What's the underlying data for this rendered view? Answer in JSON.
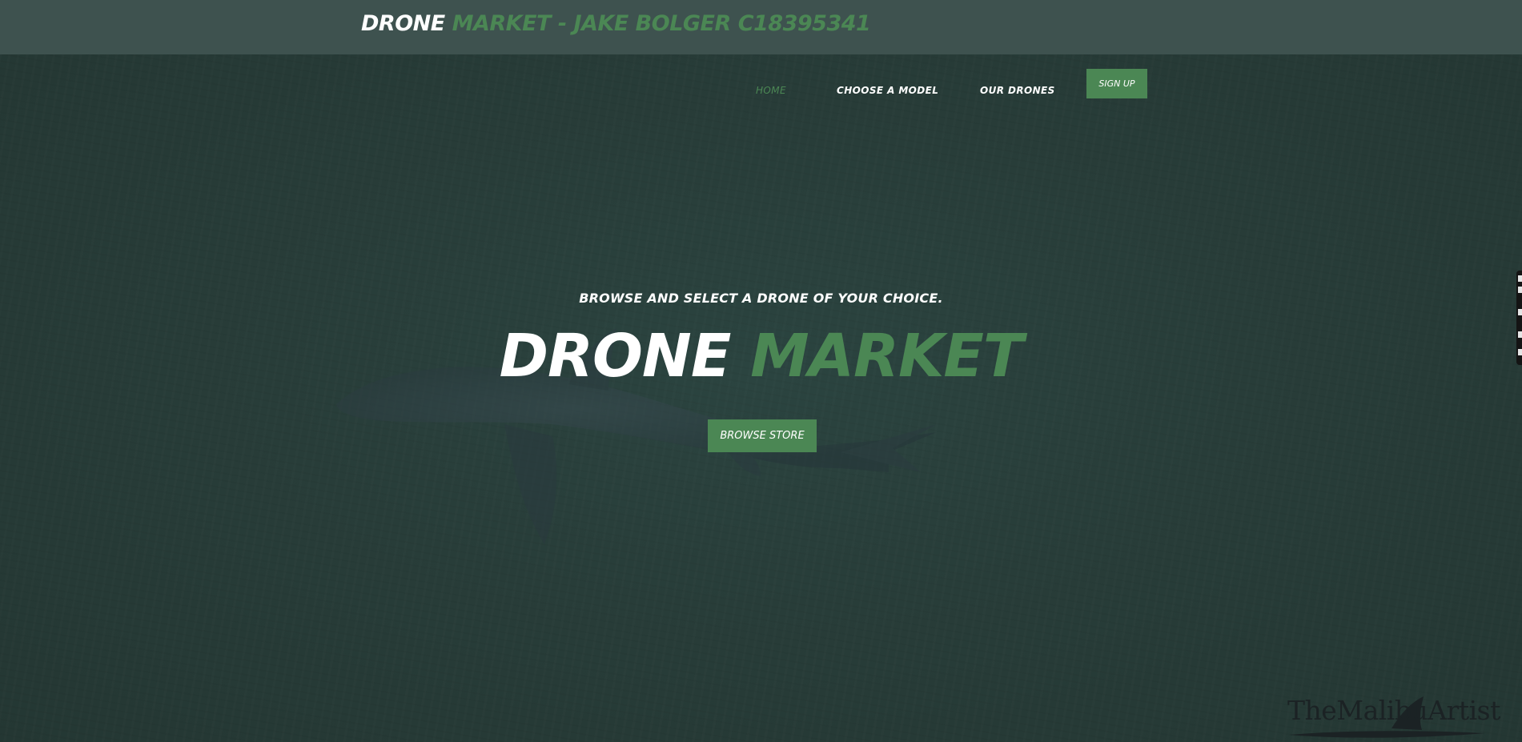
{
  "header": {
    "brand_white": "DRONE",
    "brand_green": "MARKET - JAKE BOLGER C18395341"
  },
  "nav": {
    "items": [
      {
        "label": "HOME",
        "active": true
      },
      {
        "label": "CHOOSE A MODEL",
        "active": false
      },
      {
        "label": "OUR DRONES",
        "active": false
      }
    ],
    "signup_label": "SIGN UP"
  },
  "hero": {
    "tagline": "BROWSE AND SELECT A DRONE OF YOUR CHOICE.",
    "title_white": "DRONE",
    "title_green": "MARKET",
    "button_label": "BROWSE STORE"
  },
  "watermark": {
    "text": "TheMalibuArtist"
  },
  "colors": {
    "accent": "#4b8754",
    "background": "#283d39",
    "topbar": "#3e524f",
    "text": "#ffffff"
  },
  "icons": {
    "background_subject": "shark-silhouette",
    "watermark_mark": "shark-fin-icon"
  }
}
